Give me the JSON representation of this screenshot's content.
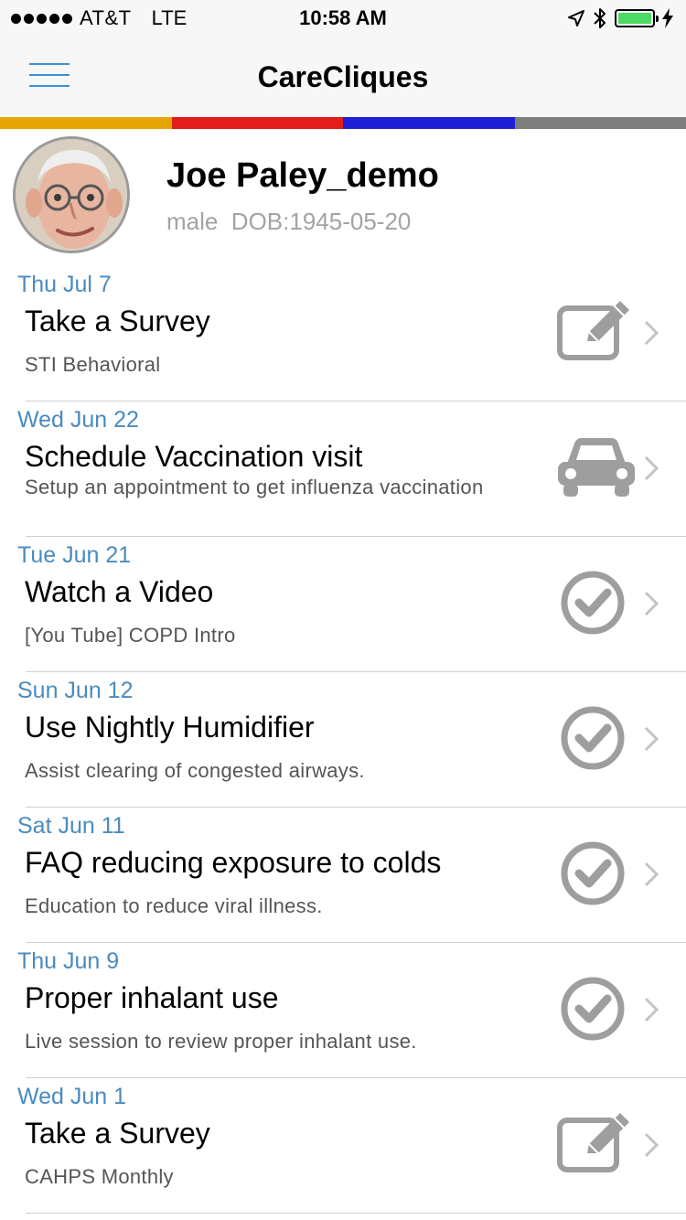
{
  "status_bar": {
    "carrier": "AT&T",
    "network": "LTE",
    "time": "10:58 AM",
    "battery_level": 1.0
  },
  "nav": {
    "title": "CareCliques"
  },
  "color_strip": [
    "#e6a600",
    "#e31c1c",
    "#1f1fd6",
    "#7f7f7f"
  ],
  "profile": {
    "name": "Joe Paley_demo",
    "meta": "male  DOB:1945-05-20"
  },
  "tasks": [
    {
      "date": "Thu Jul 7",
      "title": "Take a Survey",
      "subtitle": "STI Behavioral",
      "icon": "edit-icon"
    },
    {
      "date": "Wed Jun 22",
      "title": "Schedule Vaccination visit",
      "subtitle": "Setup an appointment to get influenza vaccination",
      "icon": "car-icon"
    },
    {
      "date": "Tue Jun 21",
      "title": "Watch a Video",
      "subtitle": "[You Tube] COPD Intro",
      "icon": "check-circle-icon"
    },
    {
      "date": "Sun Jun 12",
      "title": "Use Nightly Humidifier",
      "subtitle": "Assist clearing of congested airways.",
      "icon": "check-circle-icon"
    },
    {
      "date": "Sat Jun 11",
      "title": "FAQ reducing exposure to colds",
      "subtitle": "Education to reduce viral illness.",
      "icon": "check-circle-icon"
    },
    {
      "date": "Thu Jun 9",
      "title": "Proper inhalant use",
      "subtitle": "Live session to review proper inhalant use.",
      "icon": "check-circle-icon"
    },
    {
      "date": "Wed Jun 1",
      "title": "Take a Survey",
      "subtitle": "CAHPS Monthly",
      "icon": "edit-icon"
    }
  ],
  "colors": {
    "accent": "#3b8fd9",
    "date_text": "#4a8bbf",
    "icon_gray": "#9e9e9e"
  }
}
